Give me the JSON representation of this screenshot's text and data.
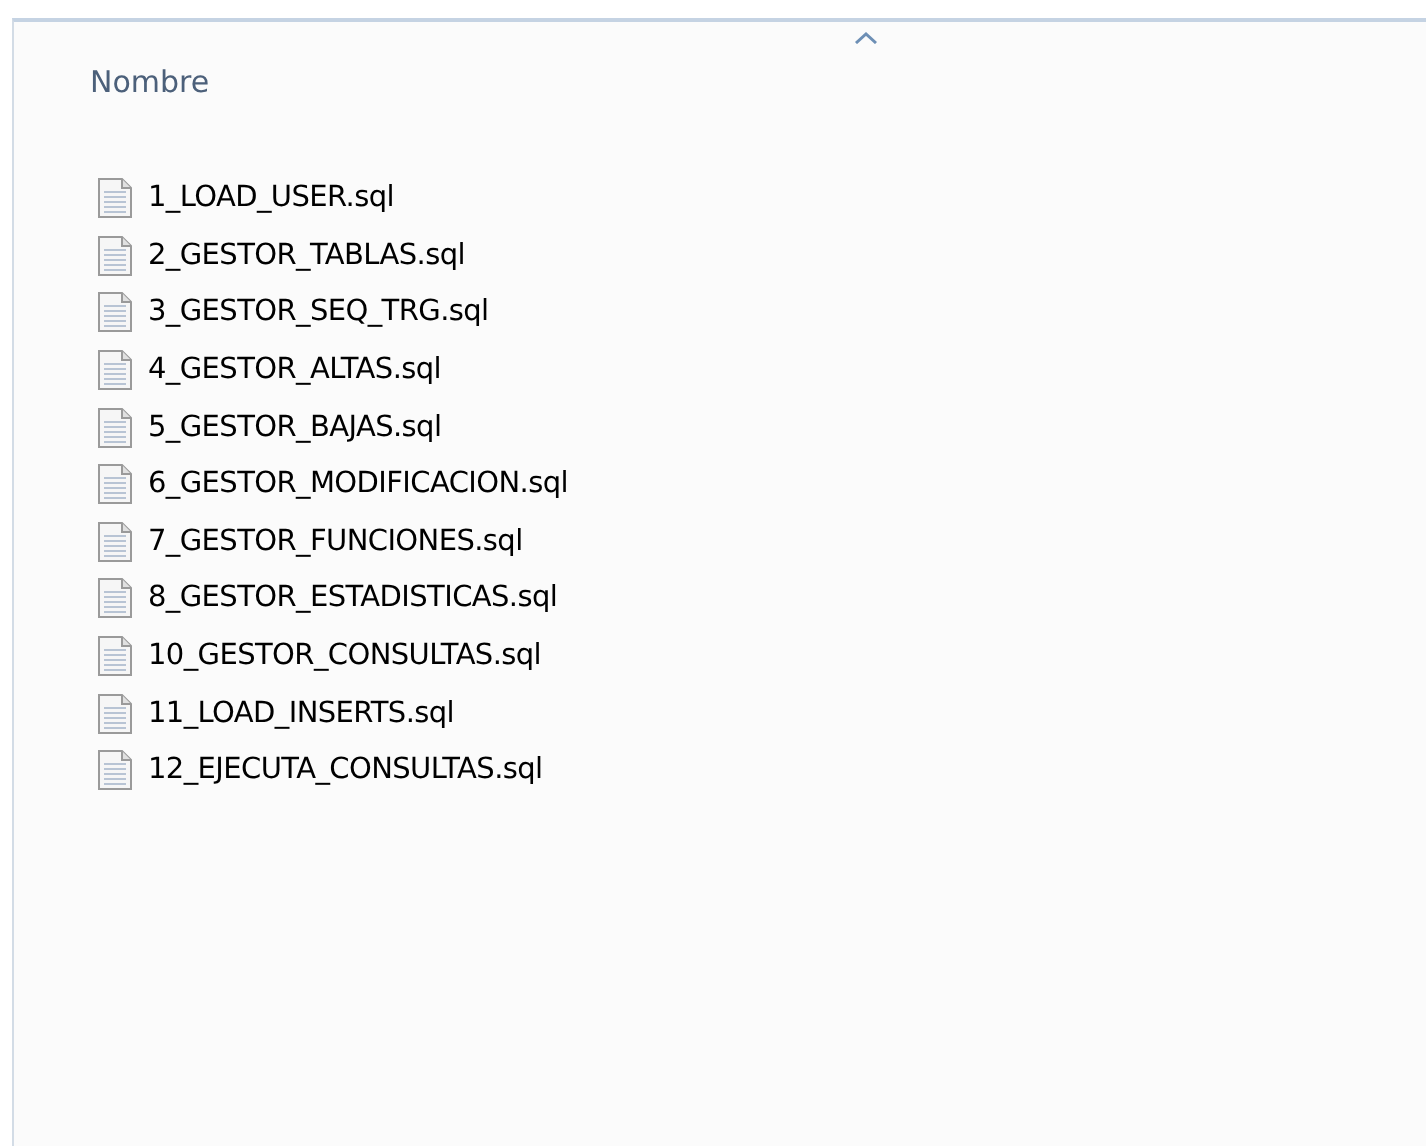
{
  "header": {
    "column_label": "Nombre"
  },
  "files": [
    {
      "name": "1_LOAD_USER.sql"
    },
    {
      "name": "2_GESTOR_TABLAS.sql"
    },
    {
      "name": "3_GESTOR_SEQ_TRG.sql"
    },
    {
      "name": "4_GESTOR_ALTAS.sql"
    },
    {
      "name": "5_GESTOR_BAJAS.sql"
    },
    {
      "name": "6_GESTOR_MODIFICACION.sql"
    },
    {
      "name": "7_GESTOR_FUNCIONES.sql"
    },
    {
      "name": "8_GESTOR_ESTADISTICAS.sql"
    },
    {
      "name": "10_GESTOR_CONSULTAS.sql"
    },
    {
      "name": "11_LOAD_INSERTS.sql"
    },
    {
      "name": "12_EJECUTA_CONSULTAS.sql"
    }
  ]
}
